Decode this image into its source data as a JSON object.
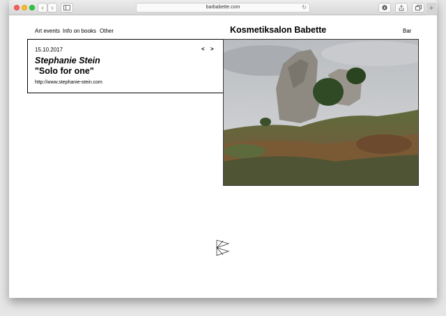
{
  "browser": {
    "url": "barbabette.com",
    "back_icon": "chevron-left-icon",
    "forward_icon": "chevron-right-icon",
    "sidebar_icon": "sidebar-icon",
    "reload_icon": "reload-icon",
    "download_icon": "download-icon",
    "share_icon": "share-icon",
    "tabs_icon": "tabs-icon",
    "new_tab_icon": "plus-icon"
  },
  "nav": {
    "items": [
      "Art events",
      "Info on books",
      "Other"
    ],
    "right": "Bar"
  },
  "site": {
    "title": "Kosmetiksalon Babette"
  },
  "event": {
    "date": "15.10.2017",
    "prev": "<",
    "next": ">",
    "artist": "Stephanie Stein",
    "title": "\"Solo for one\"",
    "link": "http://www.stephanie-stein.com"
  },
  "colors": {
    "accent": "#000000",
    "traffic_red": "#fc5f57",
    "traffic_yellow": "#fdbc2e",
    "traffic_green": "#2ac940"
  }
}
